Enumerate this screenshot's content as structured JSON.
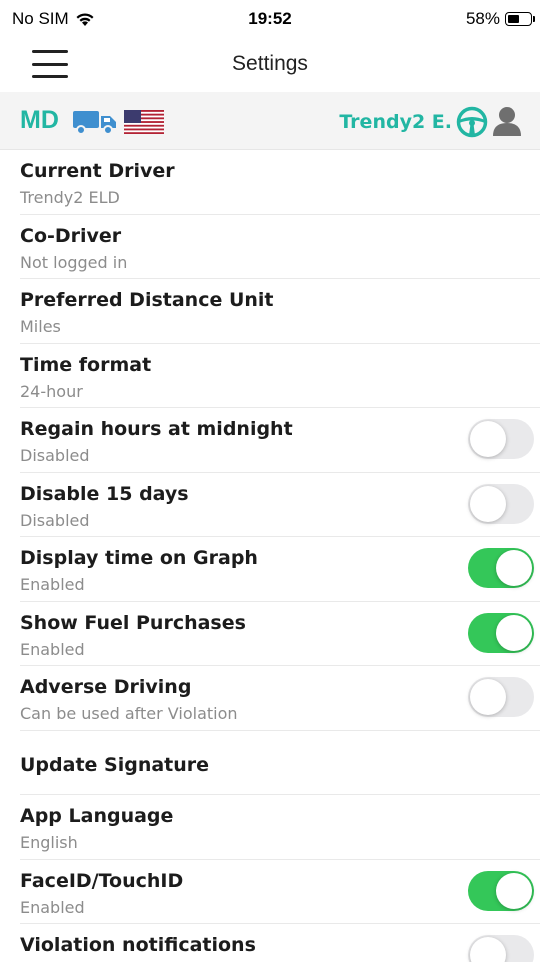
{
  "status_bar": {
    "carrier": "No SIM",
    "time": "19:52",
    "battery": "58%",
    "battery_level": 0.58
  },
  "header": {
    "title": "Settings",
    "menu_icon": "hamburger-menu-icon"
  },
  "info_bar": {
    "state_code": "MD",
    "driver_name": "Trendy2 E.",
    "accent_color": "#22b6a3",
    "icons": [
      "truck-icon",
      "us-flag-icon",
      "steering-wheel-icon",
      "user-icon"
    ]
  },
  "settings": [
    {
      "title": "Current Driver",
      "subtitle": "Trendy2 ELD"
    },
    {
      "title": "Co-Driver",
      "subtitle": "Not logged in"
    },
    {
      "title": "Preferred Distance Unit",
      "subtitle": "Miles"
    },
    {
      "title": "Time format",
      "subtitle": "24-hour"
    },
    {
      "title": "Regain hours at midnight",
      "subtitle": "Disabled",
      "toggle": false
    },
    {
      "title": "Disable 15 days",
      "subtitle": "Disabled",
      "toggle": false
    },
    {
      "title": "Display time on Graph",
      "subtitle": "Enabled",
      "toggle": true
    },
    {
      "title": "Show Fuel Purchases",
      "subtitle": "Enabled",
      "toggle": true
    },
    {
      "title": "Adverse Driving",
      "subtitle": "Can be used after Violation",
      "toggle": false
    },
    {
      "title": "Update Signature"
    },
    {
      "title": "App Language",
      "subtitle": "English"
    },
    {
      "title": "FaceID/TouchID",
      "subtitle": "Enabled",
      "toggle": true
    },
    {
      "title": "Violation notifications",
      "toggle": false
    }
  ],
  "colors": {
    "toggle_on": "#34c759",
    "toggle_off": "#e9e9eb"
  }
}
